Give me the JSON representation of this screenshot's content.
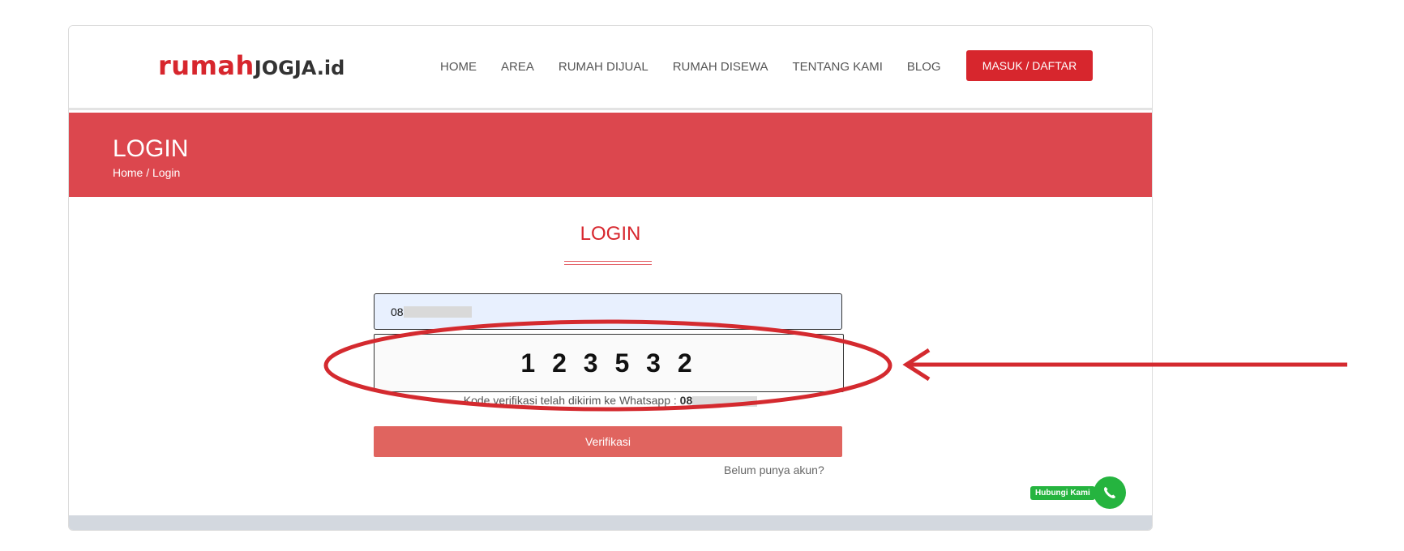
{
  "brand": {
    "part1": "rumah",
    "part2": "JOGJA",
    "part3": ".id"
  },
  "nav": {
    "items": [
      "HOME",
      "AREA",
      "RUMAH DIJUAL",
      "RUMAH DISEWA",
      "TENTANG KAMI",
      "BLOG"
    ],
    "cta": "MASUK / DAFTAR"
  },
  "banner": {
    "title": "LOGIN",
    "breadcrumb": "Home / Login"
  },
  "form": {
    "title": "LOGIN",
    "phone_prefix": "08",
    "code": "123532",
    "hint_prefix": "Kode verifikasi telah dikirim ke Whatsapp : ",
    "hint_phone_prefix": "08",
    "submit": "Verifikasi",
    "register_link": "Belum punya akun?"
  },
  "whatsapp": {
    "label": "Hubungi Kami"
  },
  "colors": {
    "brand_red": "#d7262d",
    "banner_red": "#dc474e",
    "button_red": "#e0645f",
    "annotation_red": "#d42a2f",
    "whatsapp_green": "#25b43f"
  }
}
